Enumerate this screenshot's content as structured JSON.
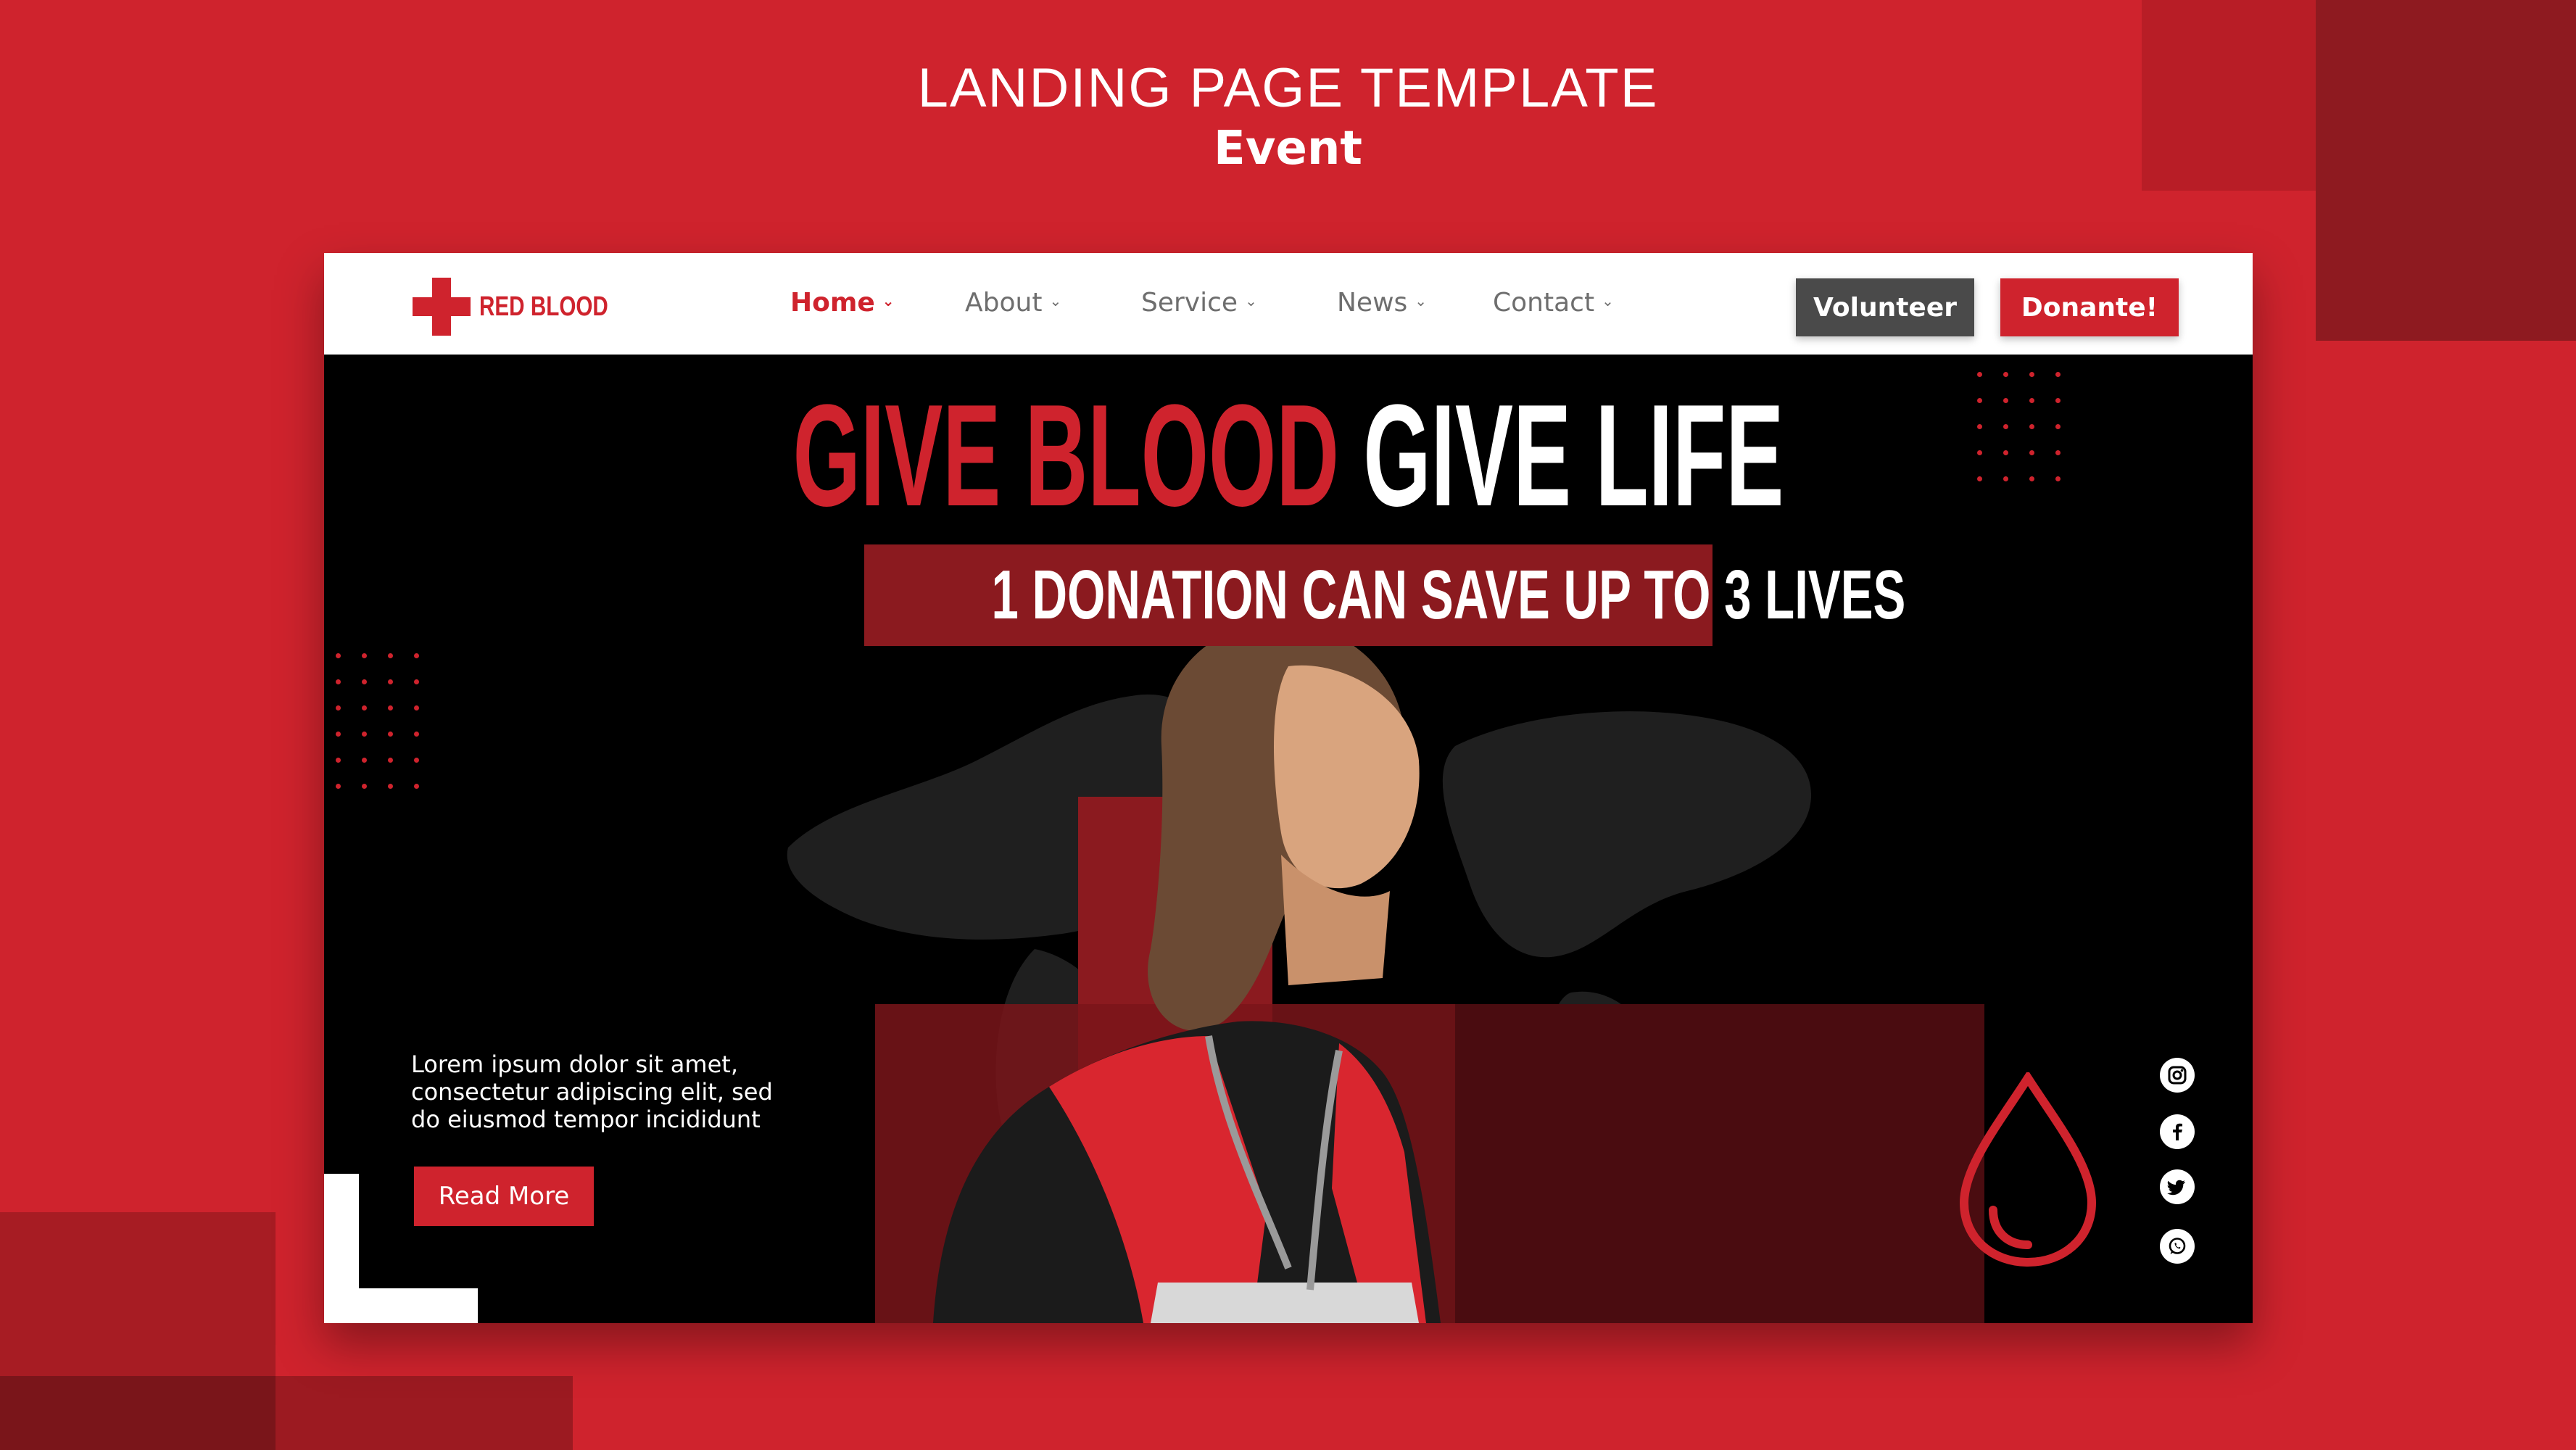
{
  "header": {
    "title": "LANDING PAGE TEMPLATE",
    "subtitle": "Event"
  },
  "brand": {
    "name": "RED BLOOD",
    "color": "#cf232d"
  },
  "nav": {
    "items": [
      {
        "label": "Home",
        "active": true
      },
      {
        "label": "About",
        "active": false
      },
      {
        "label": "Service",
        "active": false
      },
      {
        "label": "News",
        "active": false
      },
      {
        "label": "Contact",
        "active": false
      }
    ],
    "volunteer_label": "Volunteer",
    "donate_label": "Donante!"
  },
  "hero": {
    "headline_red": "GIVE BLOOD",
    "headline_white": "GIVE LIFE",
    "ribbon": "1 DONATION CAN SAVE  UP TO  3 LIVES",
    "lead_lines": [
      "Lorem ipsum dolor sit amet,",
      "consectetur adipiscing elit, sed",
      "do eiusmod tempor incididunt"
    ],
    "read_more_label": "Read More"
  },
  "socials": [
    "instagram-icon",
    "facebook-icon",
    "twitter-icon",
    "whatsapp-icon"
  ],
  "colors": {
    "accent": "#cf232d",
    "dark_red": "#8b1a1f",
    "volunteer_bg": "#4a4a4a",
    "hero_bg": "#000000"
  }
}
